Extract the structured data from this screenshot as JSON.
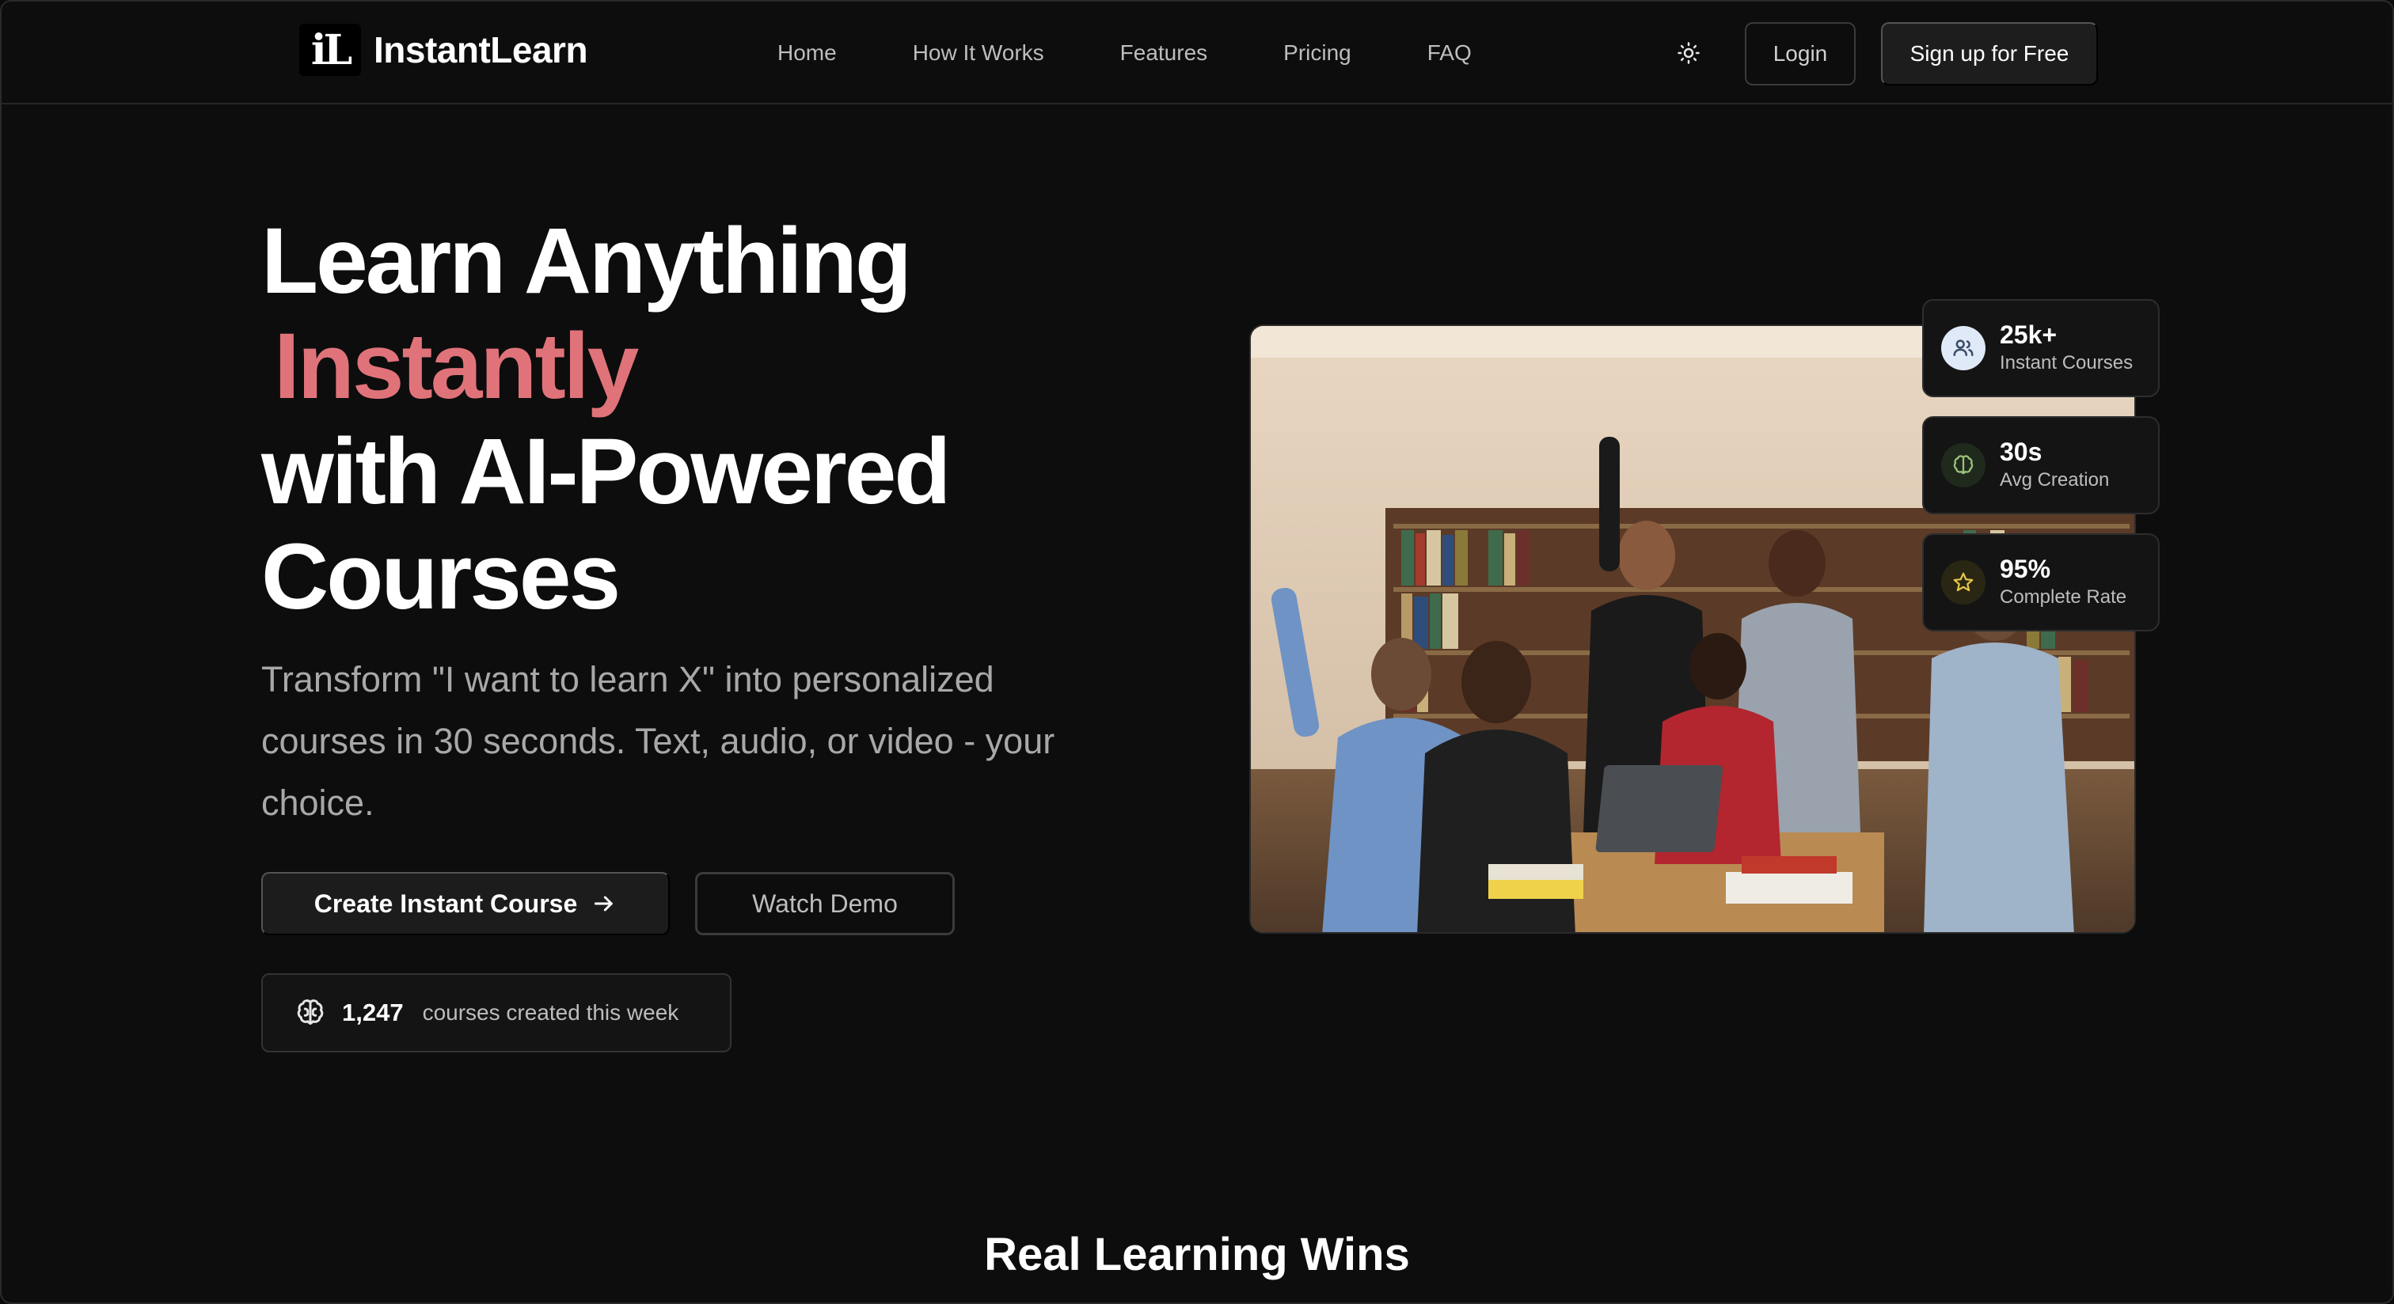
{
  "brand": {
    "logo_mark": "iL",
    "name": "InstantLearn"
  },
  "nav": {
    "links": [
      "Home",
      "How It Works",
      "Features",
      "Pricing",
      "FAQ"
    ],
    "theme_icon": "sun-icon",
    "login_label": "Login",
    "signup_label": "Sign up for Free"
  },
  "hero": {
    "line1": "Learn Anything",
    "line2_accent": "Instantly",
    "line3": "with AI-Powered",
    "line4": "Courses",
    "subtext": "Transform \"I want to learn X\" into personalized courses in 30 seconds. Text, audio, or video - your choice.",
    "cta_primary": "Create Instant Course",
    "cta_secondary": "Watch Demo",
    "weekly_count": "1,247",
    "weekly_label": "courses created this week"
  },
  "stats": [
    {
      "value": "25k+",
      "label": "Instant Courses",
      "icon": "users-icon"
    },
    {
      "value": "30s",
      "label": "Avg Creation",
      "icon": "brain-icon"
    },
    {
      "value": "95%",
      "label": "Complete Rate",
      "icon": "star-icon"
    }
  ],
  "section": {
    "title": "Real Learning Wins"
  },
  "colors": {
    "accent": "#e0737a",
    "background": "#0d0d0d",
    "card": "#141414"
  }
}
